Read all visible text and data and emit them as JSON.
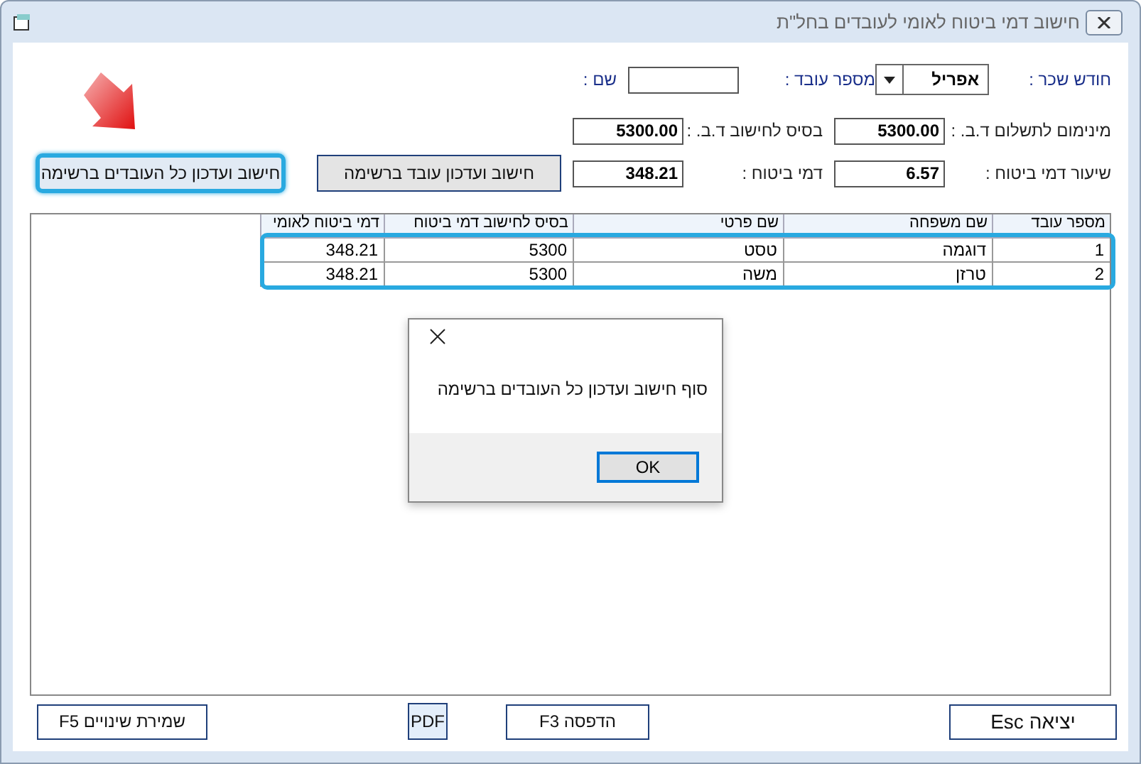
{
  "window": {
    "title": "חישוב דמי ביטוח לאומי לעובדים בחל\"ת"
  },
  "form": {
    "rows": [
      {
        "fields": [
          {
            "label": "חודש שכר :",
            "kind": "dropdown",
            "value": "אפריל"
          },
          {
            "label": "מספר עובד :",
            "kind": "input"
          },
          {
            "label": "שם :",
            "kind": "blank"
          }
        ]
      },
      {
        "fields": [
          {
            "label": "מינימום לתשלום ד.ב. :",
            "kind": "input",
            "value": "5300.00"
          },
          {
            "label": "בסיס לחישוב ד.ב. :",
            "kind": "input",
            "value": "5300.00"
          }
        ]
      },
      {
        "fields": [
          {
            "label": "שיעור דמי ביטוח :",
            "kind": "input",
            "value": "6.57"
          },
          {
            "label": "דמי ביטוח :",
            "kind": "input",
            "value": "348.21"
          }
        ]
      }
    ],
    "buttons": [
      {
        "label": "חישוב ועדכון עובד ברשימה",
        "highlighted": false
      },
      {
        "label": "חישוב ועדכון כל העובדים ברשימה",
        "highlighted": true
      }
    ]
  },
  "table": {
    "columns": [
      "מספר עובד",
      "שם משפחה",
      "שם פרטי",
      "בסיס לחישוב דמי ביטוח",
      "דמי ביטוח לאומי"
    ],
    "rows_highlighted": true,
    "rows": [
      [
        "1",
        "דוגמה",
        "טסט",
        "5300",
        "348.21"
      ],
      [
        "2",
        "טרזן",
        "משה",
        "5300",
        "348.21"
      ]
    ]
  },
  "dialog": {
    "message": "סוף חישוב ועדכון כל העובדים ברשימה",
    "button": "OK"
  },
  "footer": {
    "buttons": [
      "יציאה Esc",
      "הדפסה F3",
      "PDF",
      "שמירת שינויים F5"
    ]
  }
}
